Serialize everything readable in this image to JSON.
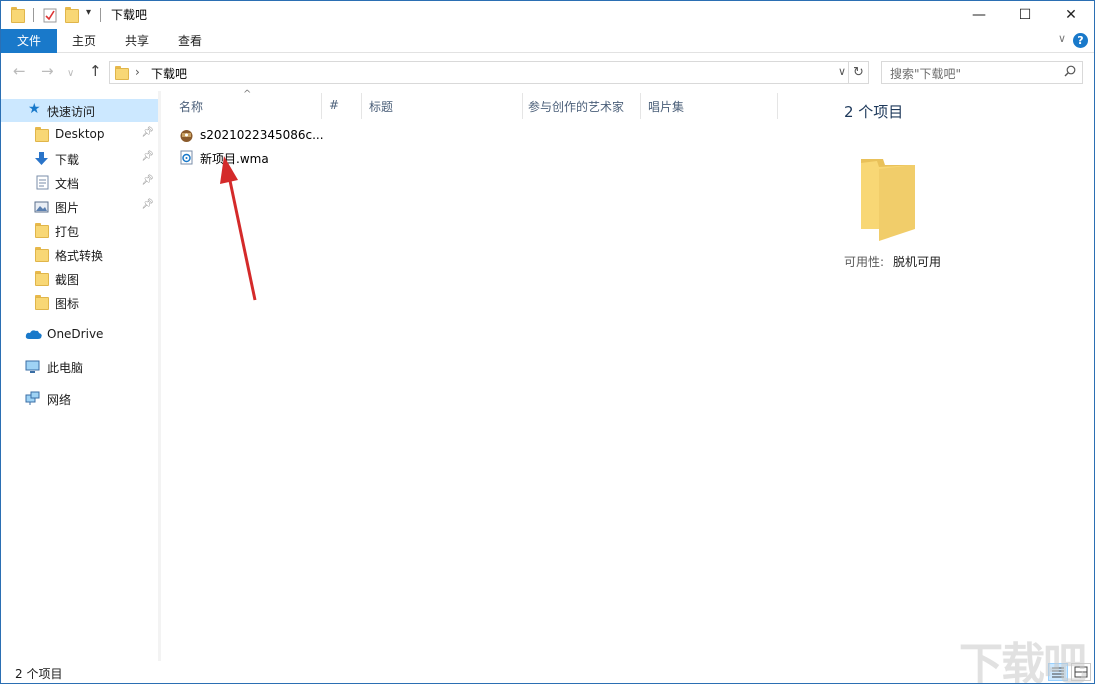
{
  "window": {
    "title": "下载吧"
  },
  "ribbon": {
    "tabs": [
      {
        "label": "文件",
        "active": true
      },
      {
        "label": "主页",
        "active": false
      },
      {
        "label": "共享",
        "active": false
      },
      {
        "label": "查看",
        "active": false
      }
    ],
    "help_label": "?"
  },
  "address": {
    "path": "下载吧",
    "search_placeholder": "搜索\"下载吧\""
  },
  "sidebar": {
    "quick_access": "快速访问",
    "items": [
      {
        "label": "Desktop",
        "pinned": true,
        "icon": "folder-icon"
      },
      {
        "label": "下载",
        "pinned": true,
        "icon": "download-icon"
      },
      {
        "label": "文档",
        "pinned": true,
        "icon": "document-icon"
      },
      {
        "label": "图片",
        "pinned": true,
        "icon": "pictures-icon"
      },
      {
        "label": "打包",
        "pinned": false,
        "icon": "folder-icon"
      },
      {
        "label": "格式转换",
        "pinned": false,
        "icon": "folder-icon"
      },
      {
        "label": "截图",
        "pinned": false,
        "icon": "folder-icon"
      },
      {
        "label": "图标",
        "pinned": false,
        "icon": "folder-icon"
      }
    ],
    "onedrive": "OneDrive",
    "this_pc": "此电脑",
    "network": "网络"
  },
  "columns": {
    "name": "名称",
    "number": "#",
    "title": "标题",
    "artist": "参与创作的艺术家",
    "album": "唱片集"
  },
  "files": [
    {
      "name": "s2021022345086c...",
      "icon": "archive-icon"
    },
    {
      "name": "新项目.wma",
      "icon": "audio-file-icon"
    }
  ],
  "details": {
    "count": "2 个项目",
    "availability_label": "可用性:",
    "availability_value": "脱机可用"
  },
  "status": {
    "count": "2 个项目"
  },
  "watermark": "下载吧",
  "colors": {
    "accent": "#1979ca",
    "selection": "#cce8ff",
    "folder": "#f8d775",
    "arrow": "#d42a2a"
  }
}
